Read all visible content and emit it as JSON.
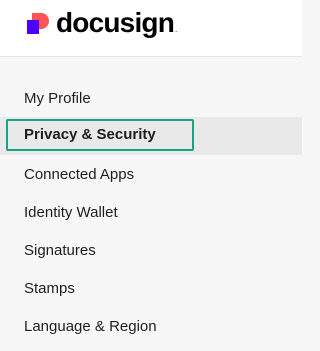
{
  "brand": {
    "name": "docusign",
    "trademark": ".",
    "logo_icon": "docusign-logo-icon",
    "colors": {
      "mark_purple": "#4c00ff",
      "mark_red": "#ff5252",
      "focus_outline": "#17a288"
    }
  },
  "sidebar": {
    "items": [
      {
        "label": "My Profile",
        "active": false
      },
      {
        "label": "Privacy & Security",
        "active": true
      },
      {
        "label": "Connected Apps",
        "active": false
      },
      {
        "label": "Identity Wallet",
        "active": false
      },
      {
        "label": "Signatures",
        "active": false
      },
      {
        "label": "Stamps",
        "active": false
      },
      {
        "label": "Language & Region",
        "active": false
      }
    ]
  }
}
